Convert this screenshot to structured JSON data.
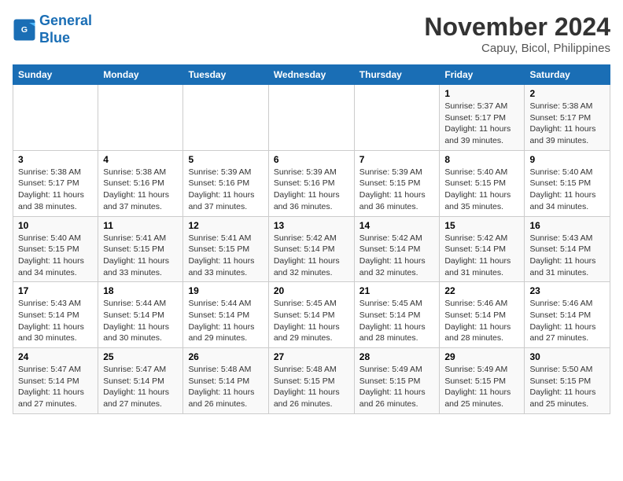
{
  "header": {
    "logo_line1": "General",
    "logo_line2": "Blue",
    "month": "November 2024",
    "location": "Capuy, Bicol, Philippines"
  },
  "days_of_week": [
    "Sunday",
    "Monday",
    "Tuesday",
    "Wednesday",
    "Thursday",
    "Friday",
    "Saturday"
  ],
  "weeks": [
    [
      {
        "day": "",
        "info": ""
      },
      {
        "day": "",
        "info": ""
      },
      {
        "day": "",
        "info": ""
      },
      {
        "day": "",
        "info": ""
      },
      {
        "day": "",
        "info": ""
      },
      {
        "day": "1",
        "info": "Sunrise: 5:37 AM\nSunset: 5:17 PM\nDaylight: 11 hours and 39 minutes."
      },
      {
        "day": "2",
        "info": "Sunrise: 5:38 AM\nSunset: 5:17 PM\nDaylight: 11 hours and 39 minutes."
      }
    ],
    [
      {
        "day": "3",
        "info": "Sunrise: 5:38 AM\nSunset: 5:17 PM\nDaylight: 11 hours and 38 minutes."
      },
      {
        "day": "4",
        "info": "Sunrise: 5:38 AM\nSunset: 5:16 PM\nDaylight: 11 hours and 37 minutes."
      },
      {
        "day": "5",
        "info": "Sunrise: 5:39 AM\nSunset: 5:16 PM\nDaylight: 11 hours and 37 minutes."
      },
      {
        "day": "6",
        "info": "Sunrise: 5:39 AM\nSunset: 5:16 PM\nDaylight: 11 hours and 36 minutes."
      },
      {
        "day": "7",
        "info": "Sunrise: 5:39 AM\nSunset: 5:15 PM\nDaylight: 11 hours and 36 minutes."
      },
      {
        "day": "8",
        "info": "Sunrise: 5:40 AM\nSunset: 5:15 PM\nDaylight: 11 hours and 35 minutes."
      },
      {
        "day": "9",
        "info": "Sunrise: 5:40 AM\nSunset: 5:15 PM\nDaylight: 11 hours and 34 minutes."
      }
    ],
    [
      {
        "day": "10",
        "info": "Sunrise: 5:40 AM\nSunset: 5:15 PM\nDaylight: 11 hours and 34 minutes."
      },
      {
        "day": "11",
        "info": "Sunrise: 5:41 AM\nSunset: 5:15 PM\nDaylight: 11 hours and 33 minutes."
      },
      {
        "day": "12",
        "info": "Sunrise: 5:41 AM\nSunset: 5:15 PM\nDaylight: 11 hours and 33 minutes."
      },
      {
        "day": "13",
        "info": "Sunrise: 5:42 AM\nSunset: 5:14 PM\nDaylight: 11 hours and 32 minutes."
      },
      {
        "day": "14",
        "info": "Sunrise: 5:42 AM\nSunset: 5:14 PM\nDaylight: 11 hours and 32 minutes."
      },
      {
        "day": "15",
        "info": "Sunrise: 5:42 AM\nSunset: 5:14 PM\nDaylight: 11 hours and 31 minutes."
      },
      {
        "day": "16",
        "info": "Sunrise: 5:43 AM\nSunset: 5:14 PM\nDaylight: 11 hours and 31 minutes."
      }
    ],
    [
      {
        "day": "17",
        "info": "Sunrise: 5:43 AM\nSunset: 5:14 PM\nDaylight: 11 hours and 30 minutes."
      },
      {
        "day": "18",
        "info": "Sunrise: 5:44 AM\nSunset: 5:14 PM\nDaylight: 11 hours and 30 minutes."
      },
      {
        "day": "19",
        "info": "Sunrise: 5:44 AM\nSunset: 5:14 PM\nDaylight: 11 hours and 29 minutes."
      },
      {
        "day": "20",
        "info": "Sunrise: 5:45 AM\nSunset: 5:14 PM\nDaylight: 11 hours and 29 minutes."
      },
      {
        "day": "21",
        "info": "Sunrise: 5:45 AM\nSunset: 5:14 PM\nDaylight: 11 hours and 28 minutes."
      },
      {
        "day": "22",
        "info": "Sunrise: 5:46 AM\nSunset: 5:14 PM\nDaylight: 11 hours and 28 minutes."
      },
      {
        "day": "23",
        "info": "Sunrise: 5:46 AM\nSunset: 5:14 PM\nDaylight: 11 hours and 27 minutes."
      }
    ],
    [
      {
        "day": "24",
        "info": "Sunrise: 5:47 AM\nSunset: 5:14 PM\nDaylight: 11 hours and 27 minutes."
      },
      {
        "day": "25",
        "info": "Sunrise: 5:47 AM\nSunset: 5:14 PM\nDaylight: 11 hours and 27 minutes."
      },
      {
        "day": "26",
        "info": "Sunrise: 5:48 AM\nSunset: 5:14 PM\nDaylight: 11 hours and 26 minutes."
      },
      {
        "day": "27",
        "info": "Sunrise: 5:48 AM\nSunset: 5:15 PM\nDaylight: 11 hours and 26 minutes."
      },
      {
        "day": "28",
        "info": "Sunrise: 5:49 AM\nSunset: 5:15 PM\nDaylight: 11 hours and 26 minutes."
      },
      {
        "day": "29",
        "info": "Sunrise: 5:49 AM\nSunset: 5:15 PM\nDaylight: 11 hours and 25 minutes."
      },
      {
        "day": "30",
        "info": "Sunrise: 5:50 AM\nSunset: 5:15 PM\nDaylight: 11 hours and 25 minutes."
      }
    ]
  ]
}
